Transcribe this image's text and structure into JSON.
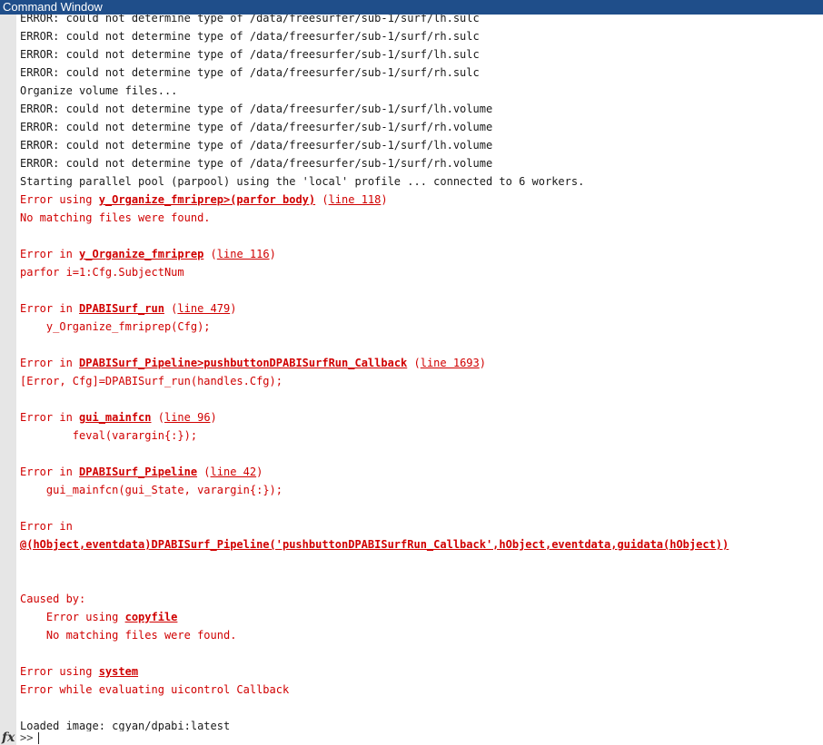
{
  "window": {
    "title": "Command Window"
  },
  "console": {
    "lines": [
      {
        "type": "text",
        "indent": "",
        "text": "ERROR: could not determine type of /data/freesurfer/sub-1/surf/lh.sulc"
      },
      {
        "type": "text",
        "indent": "",
        "text": "ERROR: could not determine type of /data/freesurfer/sub-1/surf/rh.sulc"
      },
      {
        "type": "text",
        "indent": "",
        "text": "ERROR: could not determine type of /data/freesurfer/sub-1/surf/lh.sulc"
      },
      {
        "type": "text",
        "indent": "",
        "text": "ERROR: could not determine type of /data/freesurfer/sub-1/surf/rh.sulc"
      },
      {
        "type": "text",
        "indent": "",
        "text": "Organize volume files..."
      },
      {
        "type": "text",
        "indent": "",
        "text": "ERROR: could not determine type of /data/freesurfer/sub-1/surf/lh.volume"
      },
      {
        "type": "text",
        "indent": "",
        "text": "ERROR: could not determine type of /data/freesurfer/sub-1/surf/rh.volume"
      },
      {
        "type": "text",
        "indent": "",
        "text": "ERROR: could not determine type of /data/freesurfer/sub-1/surf/lh.volume"
      },
      {
        "type": "text",
        "indent": "",
        "text": "ERROR: could not determine type of /data/freesurfer/sub-1/surf/rh.volume"
      },
      {
        "type": "text",
        "indent": "",
        "text": "Starting parallel pool (parpool) using the 'local' profile ... connected to 6 workers."
      },
      {
        "type": "trace",
        "indent": "",
        "prefix": "Error using ",
        "func": "y_Organize_fmriprep>(parfor body)",
        "ref": "line 118"
      },
      {
        "type": "errtext",
        "indent": "",
        "text": "No matching files were found."
      },
      {
        "type": "blank"
      },
      {
        "type": "trace",
        "indent": "",
        "prefix": "Error in ",
        "func": "y_Organize_fmriprep",
        "ref": "line 116"
      },
      {
        "type": "errtext",
        "indent": "",
        "text": "parfor i=1:Cfg.SubjectNum"
      },
      {
        "type": "blank"
      },
      {
        "type": "trace",
        "indent": "",
        "prefix": "Error in ",
        "func": "DPABISurf_run",
        "ref": "line 479"
      },
      {
        "type": "errtext",
        "indent": "    ",
        "text": "y_Organize_fmriprep(Cfg);"
      },
      {
        "type": "blank"
      },
      {
        "type": "trace",
        "indent": "",
        "prefix": "Error in ",
        "func": "DPABISurf_Pipeline>pushbuttonDPABISurfRun_Callback",
        "ref": "line 1693"
      },
      {
        "type": "errtext",
        "indent": "",
        "text": "[Error, Cfg]=DPABISurf_run(handles.Cfg);"
      },
      {
        "type": "blank"
      },
      {
        "type": "trace",
        "indent": "",
        "prefix": "Error in ",
        "func": "gui_mainfcn",
        "ref": "line 96"
      },
      {
        "type": "errtext",
        "indent": "        ",
        "text": "feval(varargin{:});"
      },
      {
        "type": "blank"
      },
      {
        "type": "trace",
        "indent": "",
        "prefix": "Error in ",
        "func": "DPABISurf_Pipeline",
        "ref": "line 42"
      },
      {
        "type": "errtext",
        "indent": "    ",
        "text": "gui_mainfcn(gui_State, varargin{:});"
      },
      {
        "type": "blank"
      },
      {
        "type": "errtext",
        "indent": "",
        "text": "Error in"
      },
      {
        "type": "trace",
        "indent": "",
        "prefix": "",
        "func": "@(hObject,eventdata)DPABISurf_Pipeline('pushbuttonDPABISurfRun_Callback',hObject,eventdata,guidata(hObject))",
        "ref": ""
      },
      {
        "type": "blank"
      },
      {
        "type": "blank"
      },
      {
        "type": "errtext",
        "indent": "",
        "text": "Caused by:"
      },
      {
        "type": "trace",
        "indent": "    ",
        "prefix": "Error using ",
        "func": "copyfile",
        "ref": ""
      },
      {
        "type": "errtext",
        "indent": "    ",
        "text": "No matching files were found."
      },
      {
        "type": "blank"
      },
      {
        "type": "trace",
        "indent": "",
        "prefix": "Error using ",
        "func": "system",
        "ref": ""
      },
      {
        "type": "errtext",
        "indent": "",
        "text": "Error while evaluating uicontrol Callback"
      },
      {
        "type": "blank"
      },
      {
        "type": "text",
        "indent": "",
        "text": "Loaded image: cgyan/dpabi:latest"
      }
    ]
  },
  "prompt": {
    "fx_label": "fx",
    "symbol": ">>",
    "value": ""
  }
}
